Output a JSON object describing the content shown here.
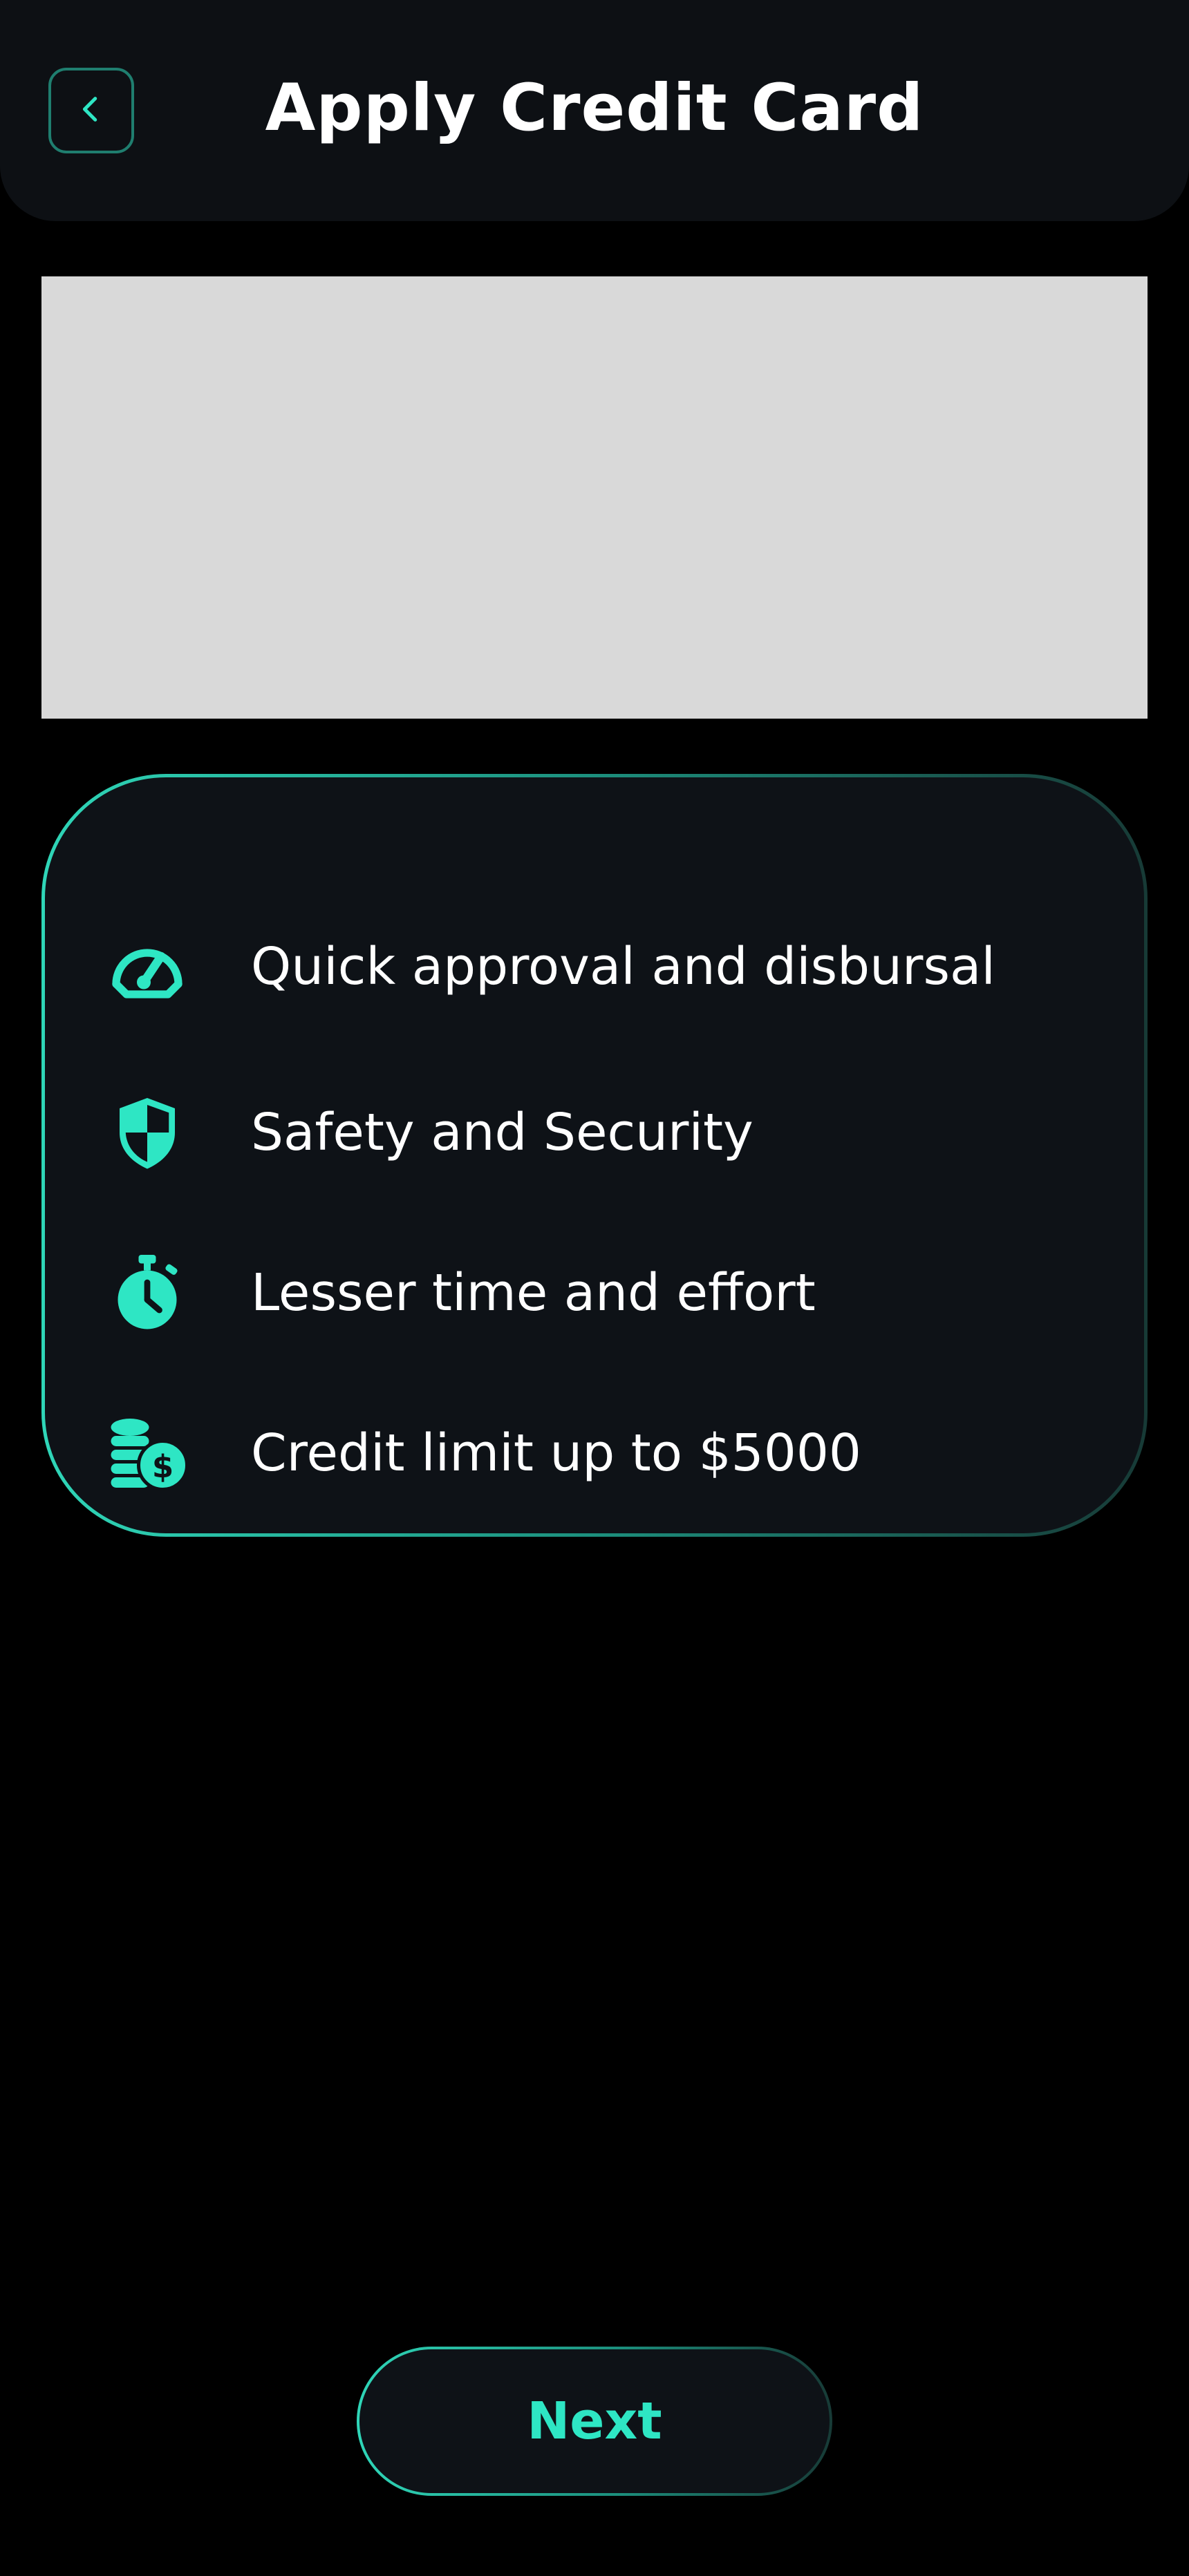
{
  "header": {
    "title": "Apply Credit Card",
    "back_icon": "chevron-left-icon"
  },
  "banner": {
    "color": "#d9d9d9"
  },
  "features": {
    "items": [
      {
        "icon": "speedometer-icon",
        "label": "Quick approval and disbursal"
      },
      {
        "icon": "shield-icon",
        "label": "Safety and Security"
      },
      {
        "icon": "stopwatch-icon",
        "label": "Lesser time and effort"
      },
      {
        "icon": "coins-dollar-icon",
        "label": "Credit limit up to $5000"
      }
    ]
  },
  "footer": {
    "next_label": "Next"
  },
  "colors": {
    "accent": "#2ee6c4",
    "background": "#000000",
    "surface": "#0e1217"
  }
}
